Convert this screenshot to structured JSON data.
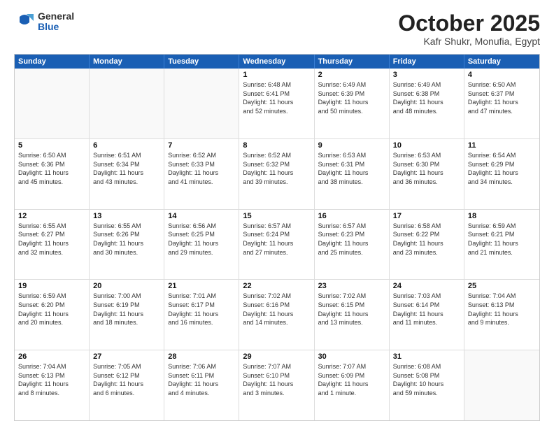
{
  "logo": {
    "general": "General",
    "blue": "Blue"
  },
  "header": {
    "title": "October 2025",
    "subtitle": "Kafr Shukr, Monufia, Egypt"
  },
  "days": [
    "Sunday",
    "Monday",
    "Tuesday",
    "Wednesday",
    "Thursday",
    "Friday",
    "Saturday"
  ],
  "weeks": [
    [
      {
        "day": "",
        "content": ""
      },
      {
        "day": "",
        "content": ""
      },
      {
        "day": "",
        "content": ""
      },
      {
        "day": "1",
        "content": "Sunrise: 6:48 AM\nSunset: 6:41 PM\nDaylight: 11 hours\nand 52 minutes."
      },
      {
        "day": "2",
        "content": "Sunrise: 6:49 AM\nSunset: 6:39 PM\nDaylight: 11 hours\nand 50 minutes."
      },
      {
        "day": "3",
        "content": "Sunrise: 6:49 AM\nSunset: 6:38 PM\nDaylight: 11 hours\nand 48 minutes."
      },
      {
        "day": "4",
        "content": "Sunrise: 6:50 AM\nSunset: 6:37 PM\nDaylight: 11 hours\nand 47 minutes."
      }
    ],
    [
      {
        "day": "5",
        "content": "Sunrise: 6:50 AM\nSunset: 6:36 PM\nDaylight: 11 hours\nand 45 minutes."
      },
      {
        "day": "6",
        "content": "Sunrise: 6:51 AM\nSunset: 6:34 PM\nDaylight: 11 hours\nand 43 minutes."
      },
      {
        "day": "7",
        "content": "Sunrise: 6:52 AM\nSunset: 6:33 PM\nDaylight: 11 hours\nand 41 minutes."
      },
      {
        "day": "8",
        "content": "Sunrise: 6:52 AM\nSunset: 6:32 PM\nDaylight: 11 hours\nand 39 minutes."
      },
      {
        "day": "9",
        "content": "Sunrise: 6:53 AM\nSunset: 6:31 PM\nDaylight: 11 hours\nand 38 minutes."
      },
      {
        "day": "10",
        "content": "Sunrise: 6:53 AM\nSunset: 6:30 PM\nDaylight: 11 hours\nand 36 minutes."
      },
      {
        "day": "11",
        "content": "Sunrise: 6:54 AM\nSunset: 6:29 PM\nDaylight: 11 hours\nand 34 minutes."
      }
    ],
    [
      {
        "day": "12",
        "content": "Sunrise: 6:55 AM\nSunset: 6:27 PM\nDaylight: 11 hours\nand 32 minutes."
      },
      {
        "day": "13",
        "content": "Sunrise: 6:55 AM\nSunset: 6:26 PM\nDaylight: 11 hours\nand 30 minutes."
      },
      {
        "day": "14",
        "content": "Sunrise: 6:56 AM\nSunset: 6:25 PM\nDaylight: 11 hours\nand 29 minutes."
      },
      {
        "day": "15",
        "content": "Sunrise: 6:57 AM\nSunset: 6:24 PM\nDaylight: 11 hours\nand 27 minutes."
      },
      {
        "day": "16",
        "content": "Sunrise: 6:57 AM\nSunset: 6:23 PM\nDaylight: 11 hours\nand 25 minutes."
      },
      {
        "day": "17",
        "content": "Sunrise: 6:58 AM\nSunset: 6:22 PM\nDaylight: 11 hours\nand 23 minutes."
      },
      {
        "day": "18",
        "content": "Sunrise: 6:59 AM\nSunset: 6:21 PM\nDaylight: 11 hours\nand 21 minutes."
      }
    ],
    [
      {
        "day": "19",
        "content": "Sunrise: 6:59 AM\nSunset: 6:20 PM\nDaylight: 11 hours\nand 20 minutes."
      },
      {
        "day": "20",
        "content": "Sunrise: 7:00 AM\nSunset: 6:19 PM\nDaylight: 11 hours\nand 18 minutes."
      },
      {
        "day": "21",
        "content": "Sunrise: 7:01 AM\nSunset: 6:17 PM\nDaylight: 11 hours\nand 16 minutes."
      },
      {
        "day": "22",
        "content": "Sunrise: 7:02 AM\nSunset: 6:16 PM\nDaylight: 11 hours\nand 14 minutes."
      },
      {
        "day": "23",
        "content": "Sunrise: 7:02 AM\nSunset: 6:15 PM\nDaylight: 11 hours\nand 13 minutes."
      },
      {
        "day": "24",
        "content": "Sunrise: 7:03 AM\nSunset: 6:14 PM\nDaylight: 11 hours\nand 11 minutes."
      },
      {
        "day": "25",
        "content": "Sunrise: 7:04 AM\nSunset: 6:13 PM\nDaylight: 11 hours\nand 9 minutes."
      }
    ],
    [
      {
        "day": "26",
        "content": "Sunrise: 7:04 AM\nSunset: 6:13 PM\nDaylight: 11 hours\nand 8 minutes."
      },
      {
        "day": "27",
        "content": "Sunrise: 7:05 AM\nSunset: 6:12 PM\nDaylight: 11 hours\nand 6 minutes."
      },
      {
        "day": "28",
        "content": "Sunrise: 7:06 AM\nSunset: 6:11 PM\nDaylight: 11 hours\nand 4 minutes."
      },
      {
        "day": "29",
        "content": "Sunrise: 7:07 AM\nSunset: 6:10 PM\nDaylight: 11 hours\nand 3 minutes."
      },
      {
        "day": "30",
        "content": "Sunrise: 7:07 AM\nSunset: 6:09 PM\nDaylight: 11 hours\nand 1 minute."
      },
      {
        "day": "31",
        "content": "Sunrise: 6:08 AM\nSunset: 5:08 PM\nDaylight: 10 hours\nand 59 minutes."
      },
      {
        "day": "",
        "content": ""
      }
    ]
  ]
}
